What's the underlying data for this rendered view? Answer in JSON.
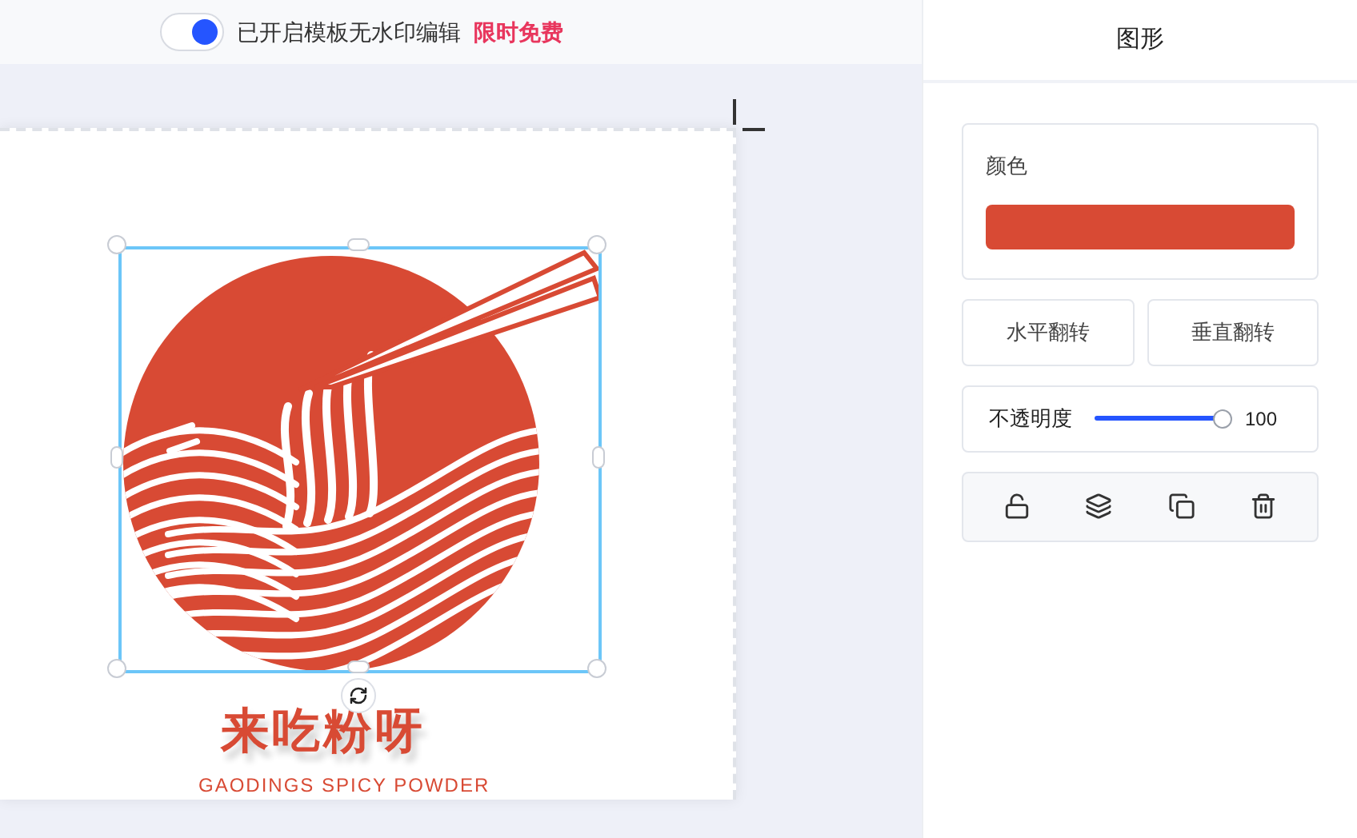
{
  "top_bar": {
    "watermark_toggle": {
      "on": true
    },
    "notice": "已开启模板无水印编辑",
    "promo": "限时免费"
  },
  "canvas": {
    "logo": {
      "selected": true,
      "color": "#d84a34"
    },
    "title": "来吃粉呀",
    "subtitle": "GAODINGS SPICY POWDER"
  },
  "panel": {
    "title": "图形",
    "color_label": "颜色",
    "color": "#d84a34",
    "buttons": [
      "水平翻转",
      "垂直翻转"
    ],
    "opacity": {
      "label": "不透明度",
      "level": 1,
      "reading": "100"
    },
    "actions": [
      {
        "kind": "unlock"
      },
      {
        "kind": "layers"
      },
      {
        "kind": "copy"
      },
      {
        "kind": "delete"
      }
    ]
  }
}
